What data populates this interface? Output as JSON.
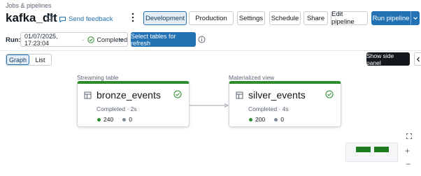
{
  "breadcrumb": "Jobs & pipelines",
  "pipeline": {
    "title": "kafka_dlt",
    "feedback_label": "Send feedback"
  },
  "toolbar": {
    "development": "Development",
    "production": "Production",
    "settings": "Settings",
    "schedule": "Schedule",
    "share": "Share",
    "edit_pipeline": "Edit pipeline",
    "run_pipeline": "Run pipeline"
  },
  "run": {
    "label": "Run:",
    "timestamp": "01/07/2025, 17:23:04",
    "separator": "·",
    "status": "Completed",
    "refresh_button": "Select tables for refresh"
  },
  "view_tabs": {
    "graph": "Graph",
    "list": "List",
    "active": "graph"
  },
  "tooltip": "Show side panel",
  "nodes": [
    {
      "type_label": "Streaming table",
      "name": "bronze_events",
      "status": "Completed · 2s",
      "upserted": "240",
      "dropped": "0"
    },
    {
      "type_label": "Materialized view",
      "name": "silver_events",
      "status": "Completed · 4s",
      "upserted": "200",
      "dropped": "0"
    }
  ],
  "colors": {
    "accent": "#2272b4",
    "success": "#2e8b2e",
    "muted": "#7f8a99"
  },
  "icons": [
    "star-icon",
    "feedback-icon",
    "kebab-icon",
    "check-circle-icon",
    "chevron-down-icon",
    "info-icon",
    "chevron-left-icon",
    "table-icon",
    "fit-view-icon",
    "zoom-in-icon",
    "zoom-out-icon"
  ]
}
